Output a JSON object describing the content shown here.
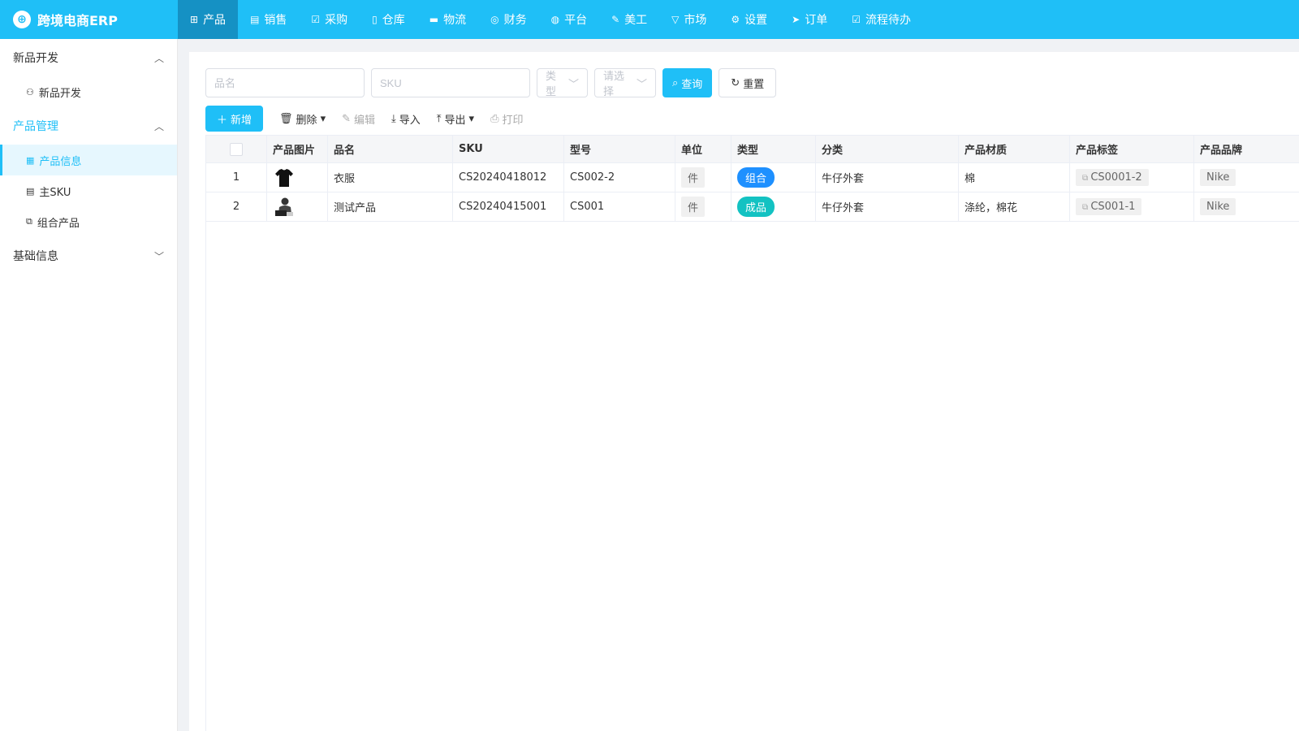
{
  "app": {
    "title": "跨境电商ERP"
  },
  "nav": [
    {
      "label": "产品",
      "icon": "grid-icon",
      "active": true
    },
    {
      "label": "销售",
      "icon": "printer-icon"
    },
    {
      "label": "采购",
      "icon": "checkbox-icon"
    },
    {
      "label": "仓库",
      "icon": "document-icon"
    },
    {
      "label": "物流",
      "icon": "truck-icon"
    },
    {
      "label": "财务",
      "icon": "coin-icon"
    },
    {
      "label": "平台",
      "icon": "globe-icon"
    },
    {
      "label": "美工",
      "icon": "edit-icon"
    },
    {
      "label": "市场",
      "icon": "shirt-icon"
    },
    {
      "label": "设置",
      "icon": "gear-icon"
    },
    {
      "label": "订单",
      "icon": "send-icon"
    },
    {
      "label": "流程待办",
      "icon": "checkbox-icon"
    }
  ],
  "sidebar": {
    "groups": [
      {
        "label": "新品开发",
        "expanded": true,
        "items": [
          {
            "label": "新品开发",
            "icon": "tree-icon"
          }
        ]
      },
      {
        "label": "产品管理",
        "expanded": true,
        "active": true,
        "items": [
          {
            "label": "产品信息",
            "icon": "table-icon",
            "active": true
          },
          {
            "label": "主SKU",
            "icon": "document-icon"
          },
          {
            "label": "组合产品",
            "icon": "combine-icon"
          }
        ]
      },
      {
        "label": "基础信息",
        "expanded": false,
        "items": []
      }
    ]
  },
  "filters": {
    "name_placeholder": "品名",
    "sku_placeholder": "SKU",
    "type_placeholder": "类型",
    "select_placeholder": "请选择",
    "query_label": "查询",
    "reset_label": "重置"
  },
  "toolbar": {
    "add_label": "新增",
    "delete_label": "删除",
    "edit_label": "编辑",
    "import_label": "导入",
    "export_label": "导出",
    "print_label": "打印"
  },
  "table": {
    "columns": [
      "产品图片",
      "品名",
      "SKU",
      "型号",
      "单位",
      "类型",
      "分类",
      "产品材质",
      "产品标签",
      "产品品牌"
    ],
    "rows": [
      {
        "idx": "1",
        "image": "tshirt",
        "name": "衣服",
        "sku": "CS20240418012",
        "model": "CS002-2",
        "unit": "件",
        "type": "组合",
        "type_color": "#1e90ff",
        "category": "牛仔外套",
        "material": "棉",
        "tag": "CS0001-2",
        "brand": "Nike"
      },
      {
        "idx": "2",
        "image": "person",
        "name": "测试产品",
        "sku": "CS20240415001",
        "model": "CS001",
        "unit": "件",
        "type": "成品",
        "type_color": "#13c2c2",
        "category": "牛仔外套",
        "material": "涤纶，棉花",
        "tag": "CS001-1",
        "brand": "Nike"
      }
    ]
  }
}
